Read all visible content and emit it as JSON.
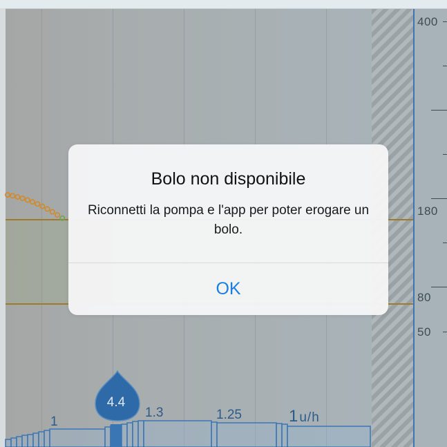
{
  "axis": {
    "ticks": [
      "400",
      "180",
      "80",
      "50"
    ]
  },
  "basal": {
    "labels": [
      "1",
      "1.3",
      "1.25"
    ],
    "current_value": "1",
    "current_unit": "u/h"
  },
  "bolus": {
    "value": "4.4"
  },
  "colors": {
    "alert_button": "#1a7de0",
    "target_line": "#a07a2c",
    "glucose_dots": "#d28a28",
    "basal": "#3b76b4"
  },
  "alert": {
    "title": "Bolo non disponibile",
    "message": "Riconnetti la pompa e l'app per poter erogare un bolo.",
    "ok_label": "OK"
  }
}
